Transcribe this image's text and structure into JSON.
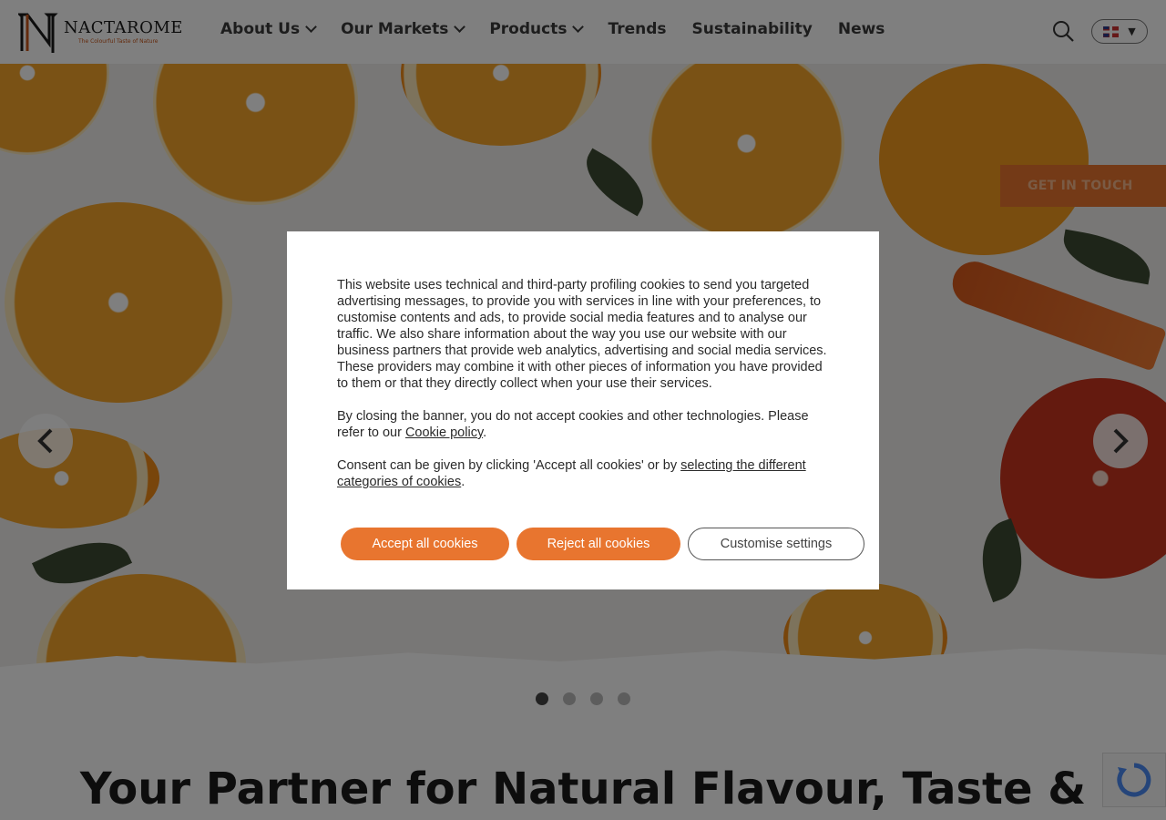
{
  "header": {
    "logo_name": "NACTAROME",
    "logo_tagline": "The Colourful Taste of Nature",
    "nav": [
      {
        "label": "About Us",
        "has_dropdown": true
      },
      {
        "label": "Our Markets",
        "has_dropdown": true
      },
      {
        "label": "Products",
        "has_dropdown": true
      },
      {
        "label": "Trends",
        "has_dropdown": false
      },
      {
        "label": "Sustainability",
        "has_dropdown": false
      },
      {
        "label": "News",
        "has_dropdown": false
      }
    ],
    "search_icon": "search-icon",
    "language_icon": "uk-flag-icon"
  },
  "hero": {
    "cta_label": "GET IN TOUCH",
    "prev_icon": "chevron-left-icon",
    "next_icon": "chevron-right-icon",
    "slides_count": 4,
    "active_slide": 1
  },
  "headline": "Your Partner for Natural Flavour, Taste &",
  "cookie_banner": {
    "paragraph1": "This website uses technical and third-party profiling cookies to send you targeted advertising messages, to provide you with services in line with your preferences, to customise contents and ads, to provide social media features and to analyse our traffic. We also share information about the way you use our website with our business partners that provide web analytics, advertising and social media services. These providers may combine it with other pieces of information you have provided to them or that they directly collect when your use their services.",
    "paragraph2_prefix": "By closing the banner, you do not accept cookies and other technologies. Please refer to our ",
    "cookie_policy_link": "Cookie policy",
    "paragraph2_suffix": ".",
    "paragraph3_prefix": "Consent can be given by clicking 'Accept all cookies' or by ",
    "categories_link": "selecting the different categories of cookies",
    "paragraph3_suffix": ".",
    "accept_label": "Accept all cookies",
    "reject_label": "Reject all cookies",
    "customise_label": "Customise settings"
  },
  "colors": {
    "accent": "#e8752f",
    "overlay": "rgba(0,0,0,0.5)"
  }
}
